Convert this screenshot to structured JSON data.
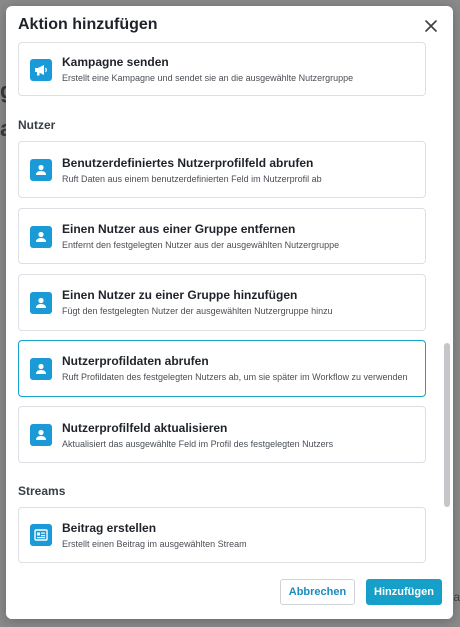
{
  "modal": {
    "title": "Aktion hinzufügen"
  },
  "sections": [
    {
      "cards": [
        {
          "title": "Kampagne senden",
          "desc": "Erstellt eine Kampagne und sendet sie an die ausgewählte Nutzergruppe",
          "icon": "megaphone-icon"
        }
      ]
    },
    {
      "label": "Nutzer",
      "cards": [
        {
          "title": "Benutzerdefiniertes Nutzerprofilfeld abrufen",
          "desc": "Ruft Daten aus einem benutzerdefinierten Feld im Nutzerprofil ab",
          "icon": "user-icon"
        },
        {
          "title": "Einen Nutzer aus einer Gruppe entfernen",
          "desc": "Entfernt den festgelegten Nutzer aus der ausgewählten Nutzergruppe",
          "icon": "user-icon"
        },
        {
          "title": "Einen Nutzer zu einer Gruppe hinzufügen",
          "desc": "Fügt den festgelegten Nutzer der ausgewählten Nutzergruppe hinzu",
          "icon": "user-icon"
        },
        {
          "title": "Nutzerprofildaten abrufen",
          "desc": "Ruft Profildaten des festgelegten Nutzers ab, um sie später im Workflow zu verwenden",
          "icon": "user-icon",
          "selected": true
        },
        {
          "title": "Nutzerprofilfeld aktualisieren",
          "desc": "Aktualisiert das ausgewählte Feld im Profil des festgelegten Nutzers",
          "icon": "user-icon"
        }
      ]
    },
    {
      "label": "Streams",
      "cards": [
        {
          "title": "Beitrag erstellen",
          "desc": "Erstellt einen Beitrag im ausgewählten Stream",
          "icon": "post-card-icon"
        }
      ]
    }
  ],
  "footer": {
    "cancel_label": "Abbrechen",
    "add_label": "Hinzufügen"
  },
  "colors": {
    "accent": "#16a0c9",
    "icon_bg": "#1a9bd7",
    "selected_border": "#17a2c8"
  }
}
